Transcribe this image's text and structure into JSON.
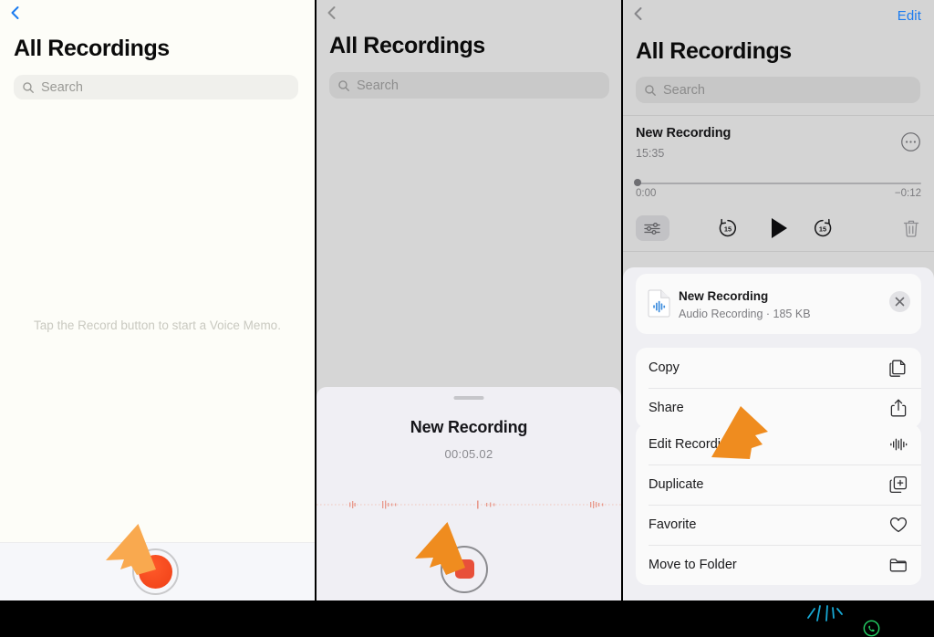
{
  "meta": {
    "app": "Voice Memos",
    "panel_count": 3
  },
  "colors": {
    "accent_blue": "#1a7bf0",
    "record_red": "#f5481f",
    "stop_red": "#e8503a",
    "cursor_orange": "#ef8c1f",
    "cursor_orange_light": "#f9a94f",
    "burst_cyan": "#17a8d4",
    "whatsapp_green": "#25d366",
    "panel1_bg": "#fdfdf8",
    "panel2_bg": "#d6d6d6",
    "panel3_bg": "#d4d4d4"
  },
  "panel1": {
    "back_icon": "chevron-left-icon",
    "title": "All Recordings",
    "search": {
      "placeholder": "Search",
      "value": "",
      "icon": "search-icon"
    },
    "empty_state": "Tap the Record button to start a Voice Memo.",
    "record_button_label": "Record"
  },
  "panel2": {
    "back_icon": "chevron-left-icon",
    "title": "All Recordings",
    "search": {
      "placeholder": "Search",
      "value": "",
      "icon": "search-icon"
    },
    "sheet": {
      "grabber": "sheet-grabber",
      "recording_name": "New Recording",
      "elapsed": "00:05.02",
      "waveform": "live-waveform",
      "stop_button_label": "Stop"
    }
  },
  "panel3": {
    "back_icon": "chevron-left-icon",
    "edit_label": "Edit",
    "title": "All Recordings",
    "search": {
      "placeholder": "Search",
      "value": "",
      "icon": "search-icon"
    },
    "item": {
      "name": "New Recording",
      "time": "15:35",
      "more_icon": "ellipsis-circle-icon",
      "progress_start": "0:00",
      "progress_remaining": "−0:12",
      "progress_percent": 0
    },
    "controls": [
      {
        "name": "trim-button",
        "icon": "sliders-icon",
        "label": "Trim"
      },
      {
        "name": "skip-back-button",
        "icon": "go-back-15-icon",
        "label": "15"
      },
      {
        "name": "play-button",
        "icon": "play-icon",
        "label": "Play"
      },
      {
        "name": "skip-forward-button",
        "icon": "go-forward-15-icon",
        "label": "15"
      },
      {
        "name": "delete-button",
        "icon": "trash-icon",
        "label": "Delete"
      }
    ],
    "share_sheet": {
      "file_name": "New Recording",
      "file_meta": "Audio Recording · 185 KB",
      "file_icon": "audio-file-icon",
      "close_icon": "close-icon",
      "groups": [
        {
          "items": [
            {
              "label": "Copy",
              "icon": "copy-icon"
            },
            {
              "label": "Share",
              "icon": "share-icon"
            }
          ]
        },
        {
          "items": [
            {
              "label": "Edit Recording",
              "icon": "waveform-icon"
            },
            {
              "label": "Duplicate",
              "icon": "duplicate-icon"
            },
            {
              "label": "Favorite",
              "icon": "heart-icon"
            },
            {
              "label": "Move to Folder",
              "icon": "folder-icon"
            }
          ]
        }
      ]
    }
  },
  "overlay": {
    "cursors": [
      {
        "name": "cursor-panel1",
        "target": "record-button"
      },
      {
        "name": "cursor-panel2",
        "target": "stop-button"
      },
      {
        "name": "cursor-panel3",
        "target": "edit-recording-row"
      }
    ],
    "tap_burst": "tap-indicator",
    "whatsapp_icon": "whatsapp-icon"
  }
}
